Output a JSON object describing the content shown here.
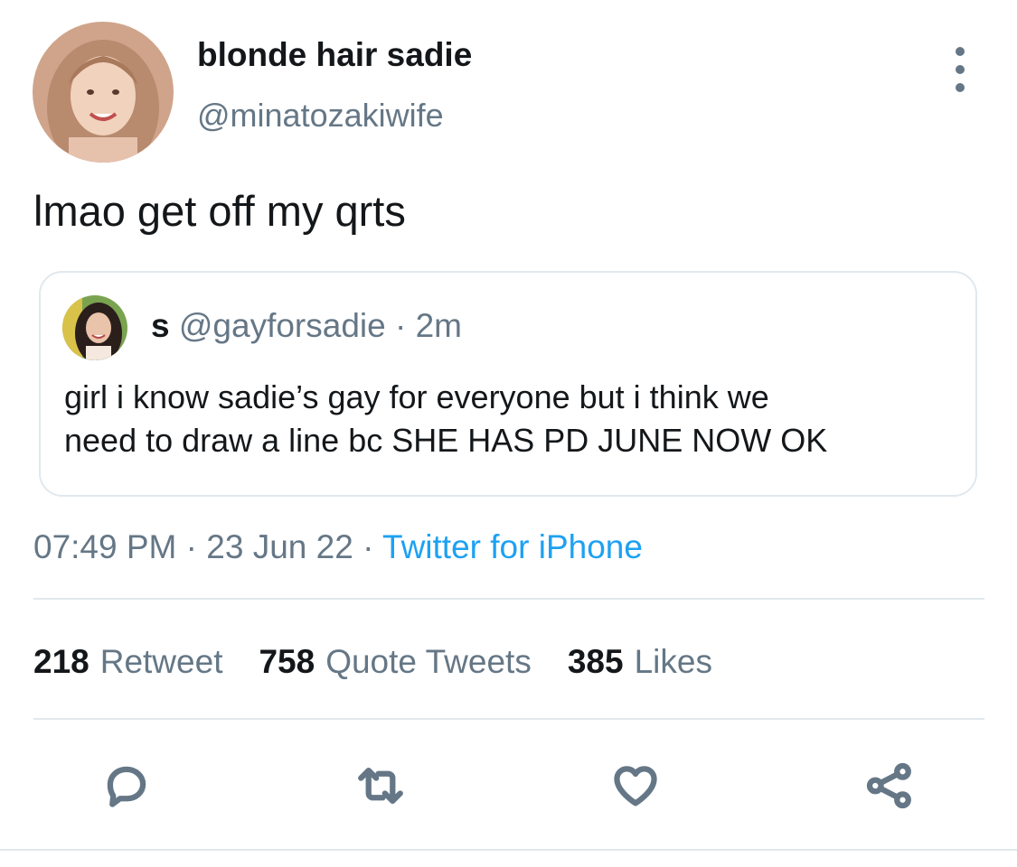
{
  "author": {
    "display_name": "blonde hair sadie",
    "handle": "@minatozakiwife"
  },
  "tweet": {
    "text": "lmao get off my qrts"
  },
  "quoted_tweet": {
    "name": "s",
    "handle": "@gayforsadie",
    "separator": "·",
    "time_ago": "2m",
    "text_lines": [
      "girl i know sadie’s gay for everyone but i think we",
      "need to draw a line bc SHE HAS PD JUNE NOW OK"
    ]
  },
  "meta": {
    "time": "07:49 PM",
    "separator": "·",
    "date": "23 Jun 22",
    "source": "Twitter for iPhone"
  },
  "stats": {
    "retweets_count": "218",
    "retweets_label": "Retweet",
    "quotes_count": "758",
    "quotes_label": "Quote Tweets",
    "likes_count": "385",
    "likes_label": "Likes"
  },
  "actions": [
    {
      "icon": "reply-icon"
    },
    {
      "icon": "retweet-icon"
    },
    {
      "icon": "like-heart-icon"
    },
    {
      "icon": "share-icon"
    }
  ],
  "colors": {
    "text_primary": "#14171a",
    "text_secondary": "#657786",
    "link": "#1da1f2",
    "border": "#e1e8ed"
  }
}
